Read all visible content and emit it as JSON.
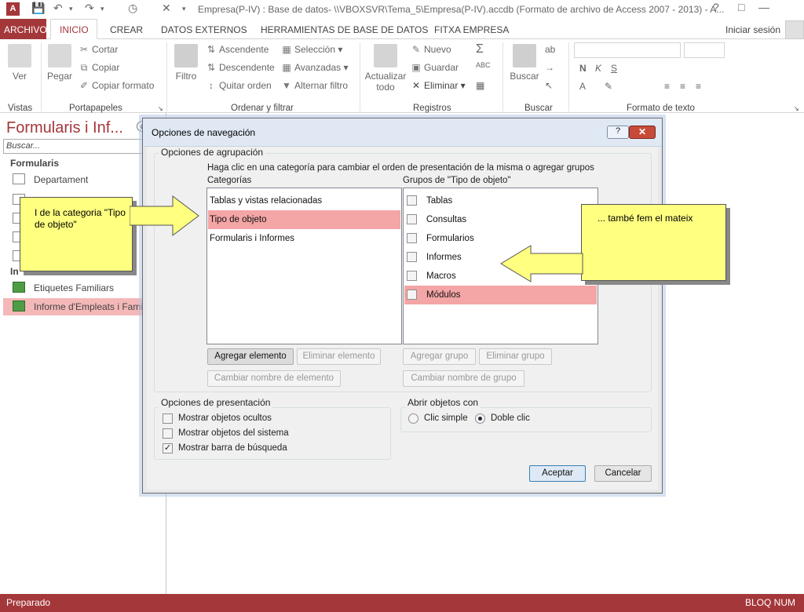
{
  "window": {
    "title": "Empresa(P-IV) : Base de datos- \\\\VBOXSVR\\Tema_5\\Empresa(P-IV).accdb (Formato de archivo de Access 2007 - 2013) - A...",
    "app_icon": "A"
  },
  "tabs": {
    "archivo": "ARCHIVO",
    "inicio": "INICIO",
    "crear": "CREAR",
    "datos_externos": "DATOS EXTERNOS",
    "herramientas": "HERRAMIENTAS DE BASE DE DATOS",
    "fitxa": "FITXA EMPRESA",
    "signin": "Iniciar sesión"
  },
  "ribbon": {
    "vistas": {
      "ver": "Ver",
      "group": "Vistas"
    },
    "portapapeles": {
      "pegar": "Pegar",
      "cortar": "Cortar",
      "copiar": "Copiar",
      "copiar_formato": "Copiar formato",
      "group": "Portapapeles"
    },
    "ordenar": {
      "filtro": "Filtro",
      "ascendente": "Ascendente",
      "descendente": "Descendente",
      "quitar_orden": "Quitar orden",
      "seleccion": "Selección",
      "avanzadas": "Avanzadas",
      "alternar": "Alternar filtro",
      "group": "Ordenar y filtrar"
    },
    "registros": {
      "actualizar": "Actualizar",
      "todo": "todo",
      "nuevo": "Nuevo",
      "guardar": "Guardar",
      "eliminar": "Eliminar",
      "group": "Registros"
    },
    "buscar": {
      "buscar": "Buscar",
      "group": "Buscar"
    },
    "formato": {
      "group": "Formato de texto",
      "bold": "N",
      "italic": "K",
      "underline": "S",
      "font_color": "A"
    }
  },
  "nav": {
    "title": "Formularis i Inf...",
    "search_placeholder": "Buscar...",
    "group1": "Formularis",
    "group2": "In",
    "items": [
      "Departament",
      "Etiquetes Familiars",
      "Informe d'Empleats i Familia"
    ]
  },
  "dialog": {
    "title": "Opciones de navegación",
    "help": "?",
    "close": "✕",
    "agrupacion_label": "Opciones de agrupación",
    "instruccion": "Haga clic en una categoría para cambiar el orden de presentación de la misma o agregar grupos",
    "categorias_label": "Categorías",
    "grupos_label": "Grupos de \"Tipo de objeto\"",
    "categorias": [
      {
        "label": "Tablas y vistas relacionadas",
        "selected": false
      },
      {
        "label": "Tipo de objeto",
        "selected": true
      },
      {
        "label": "Formularis i Informes",
        "selected": false
      }
    ],
    "grupos": [
      {
        "label": "Tablas",
        "checked": false,
        "selected": false
      },
      {
        "label": "Consultas",
        "checked": false,
        "selected": false
      },
      {
        "label": "Formularios",
        "checked": false,
        "selected": false
      },
      {
        "label": "Informes",
        "checked": false,
        "selected": false
      },
      {
        "label": "Macros",
        "checked": false,
        "selected": false
      },
      {
        "label": "Módulos",
        "checked": false,
        "selected": true
      }
    ],
    "agregar_elemento": "Agregar elemento",
    "eliminar_elemento": "Eliminar elemento",
    "cambiar_elemento": "Cambiar nombre de elemento",
    "agregar_grupo": "Agregar grupo",
    "eliminar_grupo": "Eliminar grupo",
    "cambiar_grupo": "Cambiar nombre de grupo",
    "presentacion_label": "Opciones de presentación",
    "mostrar_ocultos": {
      "label": "Mostrar objetos ocultos",
      "checked": false
    },
    "mostrar_sistema": {
      "label": "Mostrar objetos del sistema",
      "checked": false
    },
    "mostrar_barra": {
      "label": "Mostrar barra de búsqueda",
      "checked": true
    },
    "abrir_label": "Abrir objetos con",
    "clic_simple": {
      "label": "Clic simple",
      "selected": false
    },
    "doble_clic": {
      "label": "Doble clic",
      "selected": true
    },
    "aceptar": "Aceptar",
    "cancelar": "Cancelar"
  },
  "callouts": {
    "left": "I de la categoria \"Tipo de objeto\"",
    "right": "... també fem el mateix"
  },
  "status": {
    "left": "Preparado",
    "right": "BLOQ NUM"
  },
  "colors": {
    "accent": "#a4373a",
    "selection": "#f4a5a5",
    "callout": "#ffff80"
  }
}
